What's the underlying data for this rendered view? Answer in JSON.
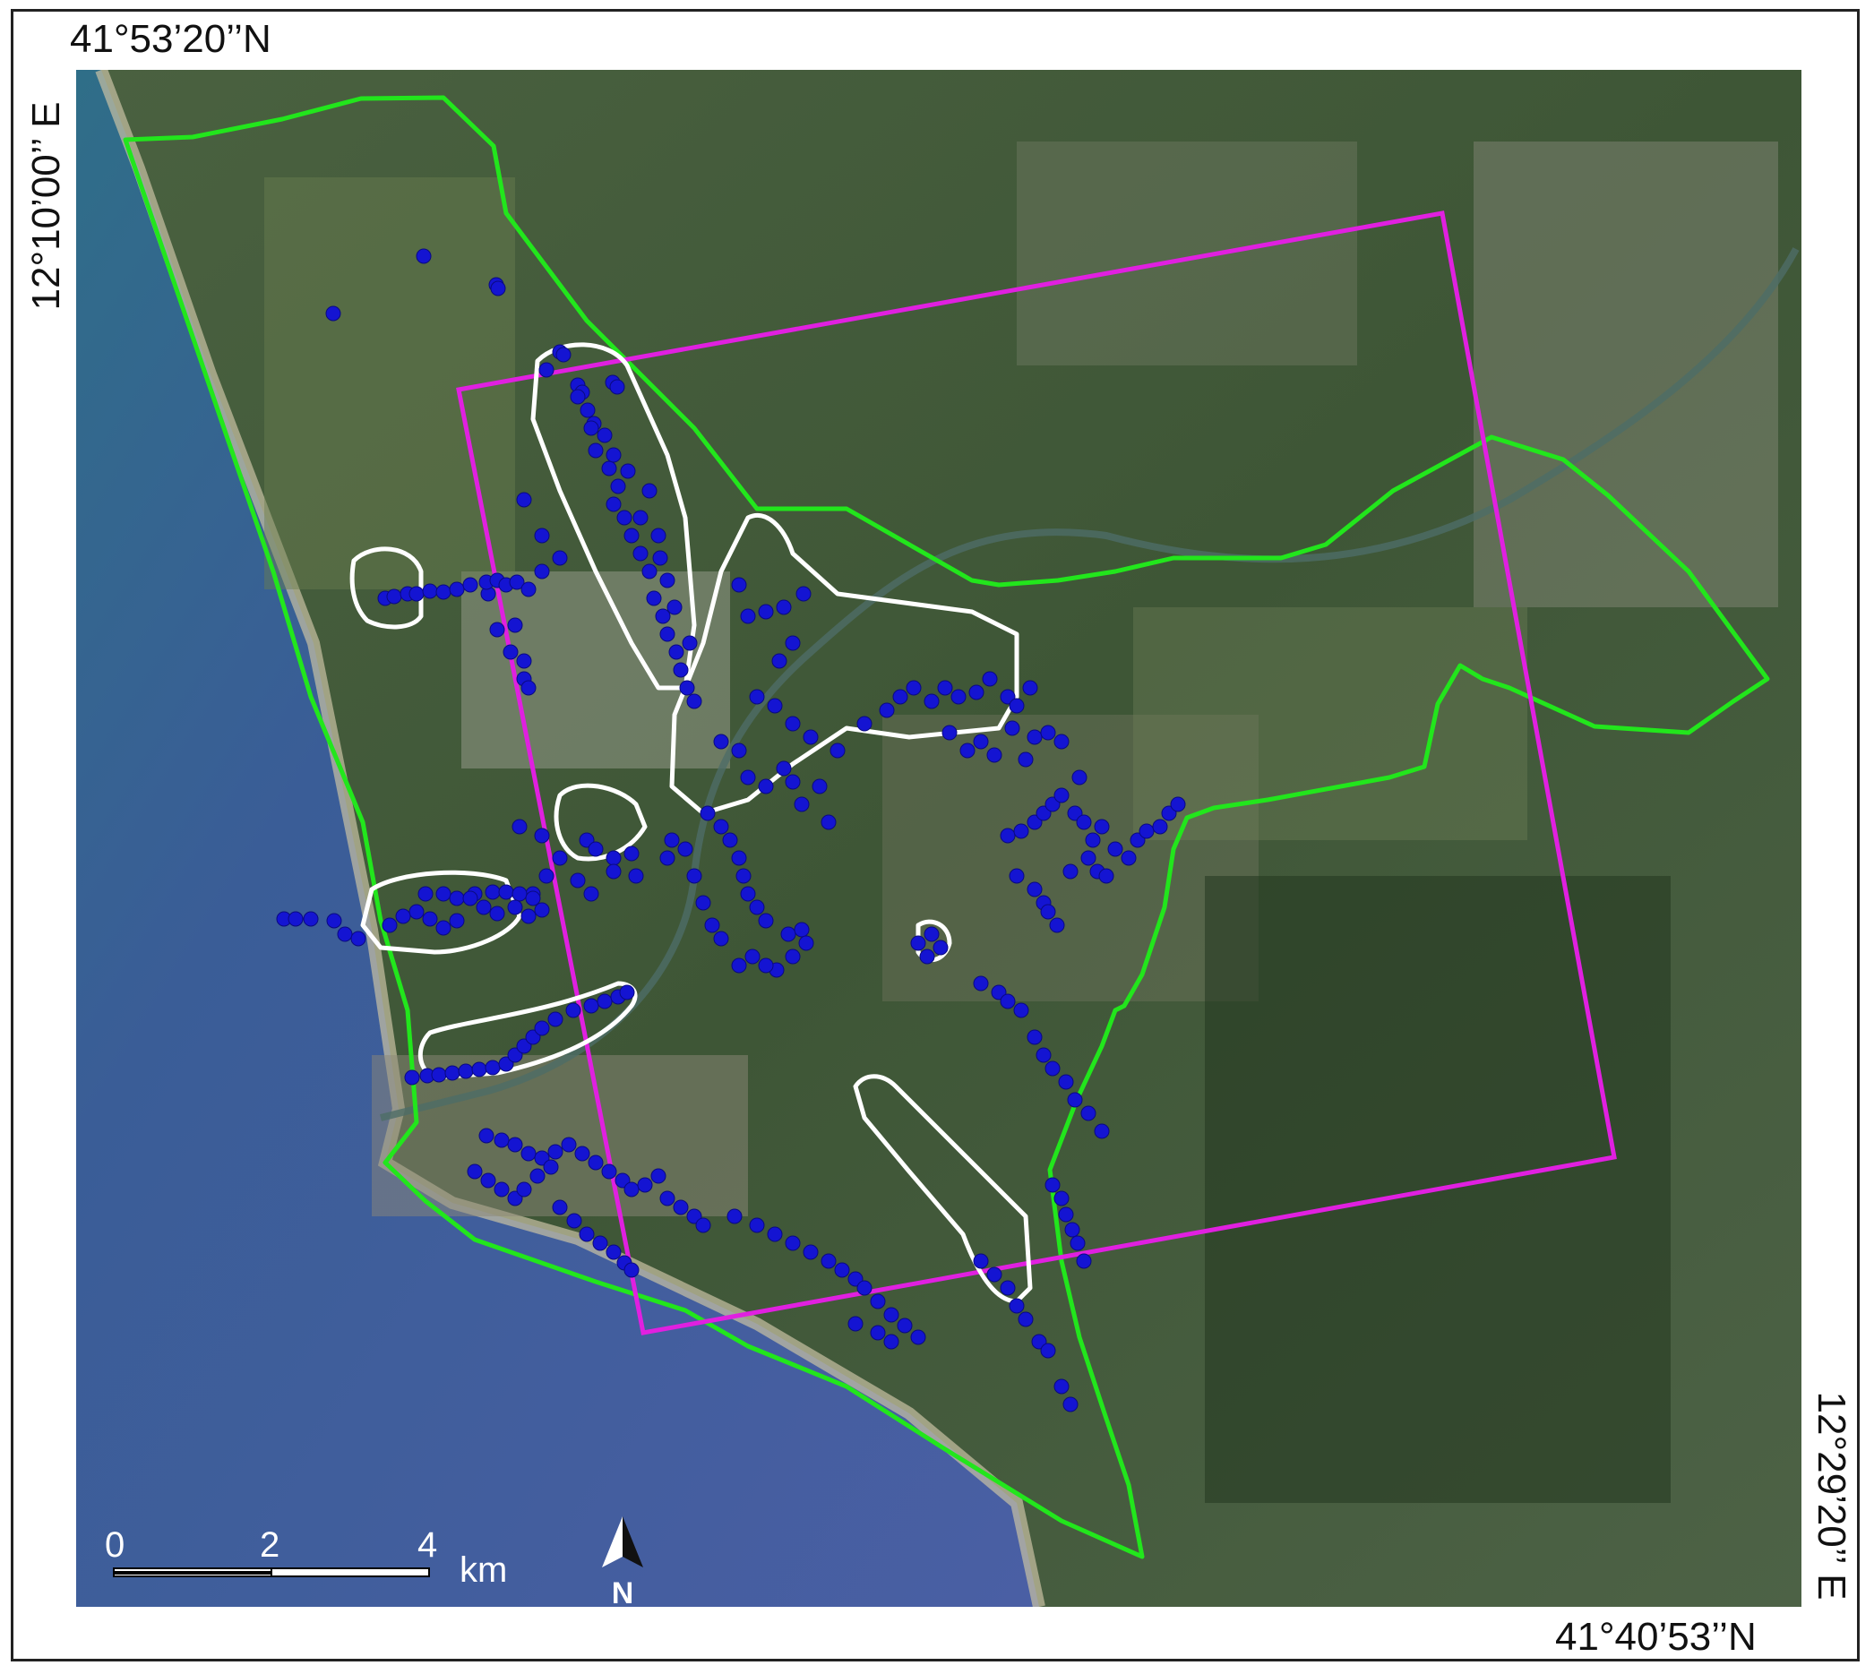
{
  "coordinates": {
    "top_left_lat": "41°53’20’’N",
    "left_lon": "12°10’00’’ E",
    "right_lon": "12°29’20’’ E",
    "bottom_right_lat": "41°40’53’’N"
  },
  "scale_bar": {
    "ticks": [
      "0",
      "2",
      "4"
    ],
    "unit": "km"
  },
  "north_arrow": {
    "label": "N"
  },
  "colors": {
    "sea": "#3f5f9a",
    "land": "#3b5434",
    "study_area_outline": "#22e61c",
    "frame_outline": "#e020e0",
    "cluster_outline": "#ffffff",
    "points": "#1414d2",
    "scale_bar": "#ffffff"
  },
  "layers": {
    "basemap": "satellite-imagery",
    "study_area": "green-polygon",
    "frame": "magenta-quadrilateral",
    "clusters": "white-outline-polygons",
    "points": "blue-dots"
  }
}
